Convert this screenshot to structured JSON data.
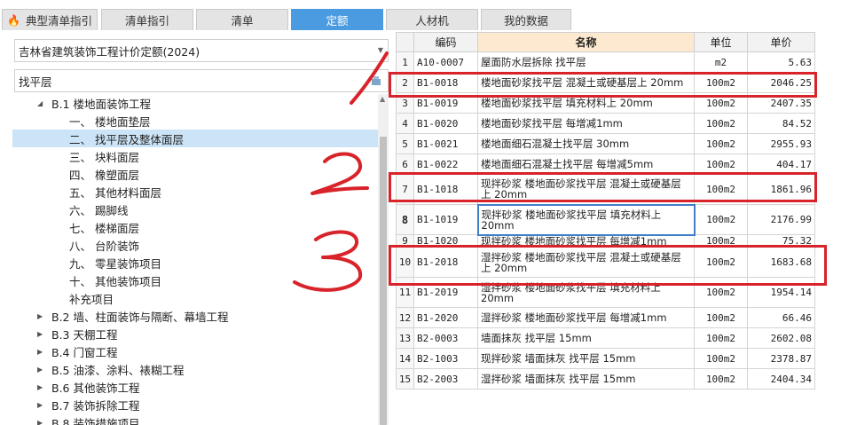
{
  "tabs": [
    {
      "label": "典型清单指引",
      "active": false
    },
    {
      "label": "清单指引",
      "active": false
    },
    {
      "label": "清单",
      "active": false
    },
    {
      "label": "定额",
      "active": true
    },
    {
      "label": "人材机",
      "active": false
    },
    {
      "label": "我的数据",
      "active": false
    }
  ],
  "left_panel": {
    "quota_library": "吉林省建筑装饰工程计价定额(2024)",
    "search_value": "找平层",
    "tree": [
      {
        "label": "B.1 楼地面装饰工程",
        "expanded": true,
        "selected": false
      },
      {
        "label": "一、 楼地面垫层",
        "selected": false
      },
      {
        "label": "二、 找平层及整体面层",
        "selected": true
      },
      {
        "label": "三、 块料面层",
        "selected": false
      },
      {
        "label": "四、 橡塑面层",
        "selected": false
      },
      {
        "label": "五、 其他材料面层",
        "selected": false
      },
      {
        "label": "六、 踢脚线",
        "selected": false
      },
      {
        "label": "七、 楼梯面层",
        "selected": false
      },
      {
        "label": "八、 台阶装饰",
        "selected": false
      },
      {
        "label": "九、 零星装饰项目",
        "selected": false
      },
      {
        "label": "十、 其他装饰项目",
        "selected": false
      },
      {
        "label": "补充项目",
        "selected": false
      },
      {
        "label": "B.2 墙、柱面装饰与隔断、幕墙工程",
        "expanded": false
      },
      {
        "label": "B.3 天棚工程",
        "expanded": false
      },
      {
        "label": "B.4 门窗工程",
        "expanded": false
      },
      {
        "label": "B.5 油漆、涂料、裱糊工程",
        "expanded": false
      },
      {
        "label": "B.6 其他装饰工程",
        "expanded": false
      },
      {
        "label": "B.7 装饰拆除工程",
        "expanded": false
      },
      {
        "label": "B.8 装饰措施项目",
        "expanded": false
      }
    ]
  },
  "table": {
    "headers": {
      "code": "编码",
      "name": "名称",
      "unit": "单位",
      "price": "单价"
    },
    "rows": [
      {
        "index": "1",
        "code": "A10-0007",
        "name": "屋面防水层拆除 找平层",
        "unit": "m2",
        "price": "5.63"
      },
      {
        "index": "2",
        "code": "B1-0018",
        "name": "楼地面砂浆找平层 混凝土或硬基层上 20mm",
        "unit": "100m2",
        "price": "2046.25"
      },
      {
        "index": "3",
        "code": "B1-0019",
        "name": "楼地面砂浆找平层 填充材料上 20mm",
        "unit": "100m2",
        "price": "2407.35"
      },
      {
        "index": "4",
        "code": "B1-0020",
        "name": "楼地面砂浆找平层 每增减1mm",
        "unit": "100m2",
        "price": "84.52"
      },
      {
        "index": "5",
        "code": "B1-0021",
        "name": "楼地面细石混凝土找平层 30mm",
        "unit": "100m2",
        "price": "2955.93"
      },
      {
        "index": "6",
        "code": "B1-0022",
        "name": "楼地面细石混凝土找平层 每增减5mm",
        "unit": "100m2",
        "price": "404.17"
      },
      {
        "index": "7",
        "code": "B1-1018",
        "name": "现拌砂浆 楼地面砂浆找平层 混凝土或硬基层上 20mm",
        "unit": "100m2",
        "price": "1861.96"
      },
      {
        "index": "8",
        "code": "B1-1019",
        "name": "现拌砂浆 楼地面砂浆找平层 填充材料上 20mm",
        "unit": "100m2",
        "price": "2176.99"
      },
      {
        "index": "9",
        "code": "B1-1020",
        "name": "现拌砂浆 楼地面砂浆找平层 每增减1mm",
        "unit": "100m2",
        "price": "75.32"
      },
      {
        "index": "10",
        "code": "B1-2018",
        "name": "湿拌砂浆 楼地面砂浆找平层 混凝土或硬基层上 20mm",
        "unit": "100m2",
        "price": "1683.68"
      },
      {
        "index": "11",
        "code": "B1-2019",
        "name": "湿拌砂浆 楼地面砂浆找平层 填充材料上 20mm",
        "unit": "100m2",
        "price": "1954.14"
      },
      {
        "index": "12",
        "code": "B1-2020",
        "name": "湿拌砂浆 楼地面砂浆找平层 每增减1mm",
        "unit": "100m2",
        "price": "66.46"
      },
      {
        "index": "13",
        "code": "B2-0003",
        "name": "墙面抹灰 找平层 15mm",
        "unit": "100m2",
        "price": "2602.08"
      },
      {
        "index": "14",
        "code": "B2-1003",
        "name": "现拌砂浆 墙面抹灰 找平层 15mm",
        "unit": "100m2",
        "price": "2378.87"
      },
      {
        "index": "15",
        "code": "B2-2003",
        "name": "湿拌砂浆 墙面抹灰 找平层 15mm",
        "unit": "100m2",
        "price": "2404.34"
      }
    ]
  },
  "annotations": {
    "ink_color": "#d8232a",
    "marks": [
      "/",
      "2",
      "3"
    ]
  }
}
